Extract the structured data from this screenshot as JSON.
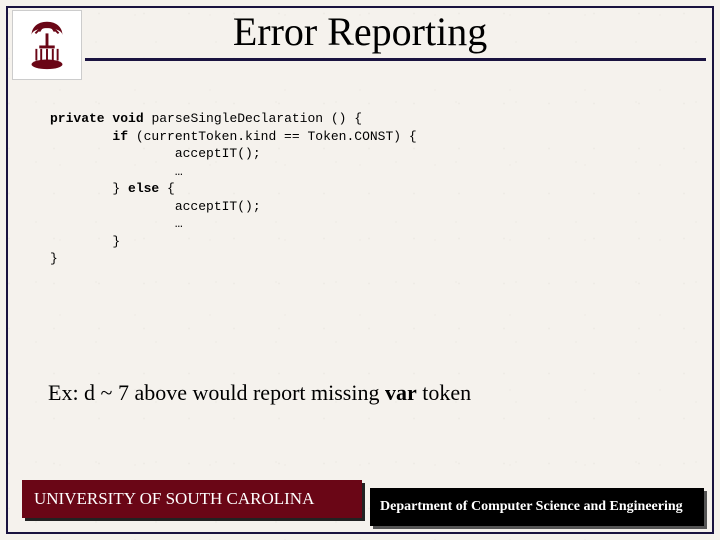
{
  "title": "Error Reporting",
  "code": {
    "kw_private": "private",
    "kw_void": "void",
    "sig": " parseSingleDeclaration () {",
    "kw_if": "if",
    "cond": " (currentToken.kind == Token.CONST) {",
    "accept": "acceptIT();",
    "ellipsis": "…",
    "close_else_open": "} ",
    "kw_else": "else",
    "else_open": " {",
    "close": "}"
  },
  "example": {
    "prefix": "Ex: d ~ 7  above would report missing ",
    "bold": "var",
    "suffix": " token"
  },
  "footer": {
    "left": "UNIVERSITY OF SOUTH CAROLINA",
    "right": "Department of Computer Science and Engineering"
  }
}
